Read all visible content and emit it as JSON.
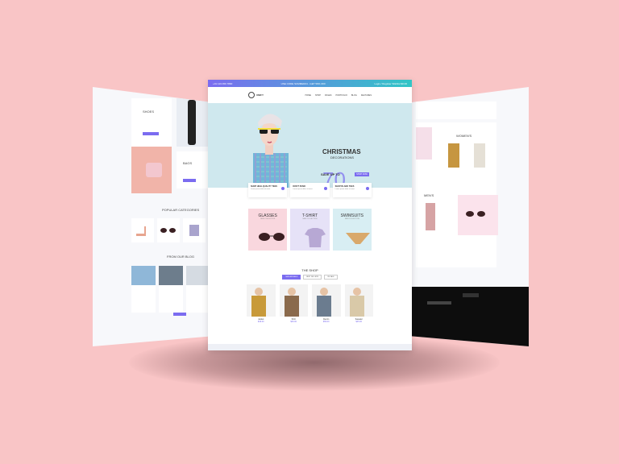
{
  "main": {
    "topbar": {
      "left": "+01 123 456 7890",
      "center": "USE CODE SUMMER24 - GET 50% OFF",
      "right": "Login / Register   Wishlist   $0.00"
    },
    "logo": "UNIFY",
    "nav": [
      "HOME",
      "SHOP",
      "PAGES",
      "PORTFOLIO",
      "BLOG",
      "FEATURES"
    ],
    "hero": {
      "title": "CHRISTMAS",
      "subtitle": "DECORATIONS",
      "save": "SAVE UP TO",
      "percent": "70",
      "off": "65% OFF",
      "button": "SHOP NOW"
    },
    "features": [
      {
        "title": "SHOP HIGH-QUALITY TEES",
        "desc": "Lorem ipsum dolor sit amet"
      },
      {
        "title": "DON'T PANIC",
        "desc": "Lorem ipsum dolor sit amet"
      },
      {
        "title": "SHOP BLANK TEES",
        "desc": "Lorem ipsum dolor sit amet"
      }
    ],
    "categories": [
      {
        "title": "GLASSES",
        "sub": "NEW COLLECTION",
        "color": "#f9d7de"
      },
      {
        "title": "T-SHIRT",
        "sub": "NEW COLLECTION",
        "color": "#e6e2f7"
      },
      {
        "title": "SWIMSUITS",
        "sub": "NEW COLLECTION",
        "color": "#d8eef3"
      }
    ],
    "shop": {
      "title": "THE SHOP",
      "tabs": [
        "NEW ARRIVALS",
        "BEST SELLERS",
        "ON SALE"
      ]
    },
    "products": [
      {
        "name": "Jacket",
        "price": "$49.00",
        "color": "#c89a3a"
      },
      {
        "name": "Shirt",
        "price": "$39.00",
        "color": "#8a6a4c"
      },
      {
        "name": "Denim",
        "price": "$59.00",
        "color": "#6b7c8f"
      },
      {
        "name": "Sweater",
        "price": "$45.00",
        "color": "#d9c9a8"
      }
    ]
  },
  "left": {
    "shoes": "SHOES",
    "bags": "BAGS",
    "popular": "POPULAR CATEGORIES",
    "blog": "FROM OUR BLOG"
  },
  "right": {
    "women": "WOMEN'S",
    "mens": "MEN'S"
  }
}
